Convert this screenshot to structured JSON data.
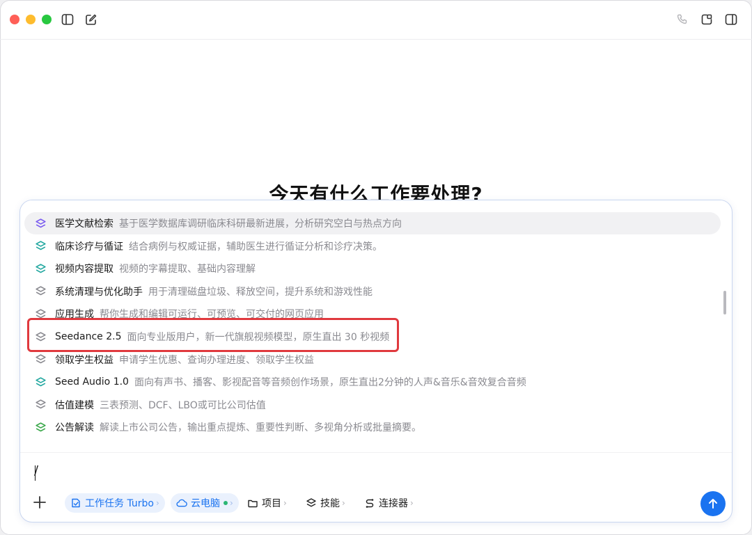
{
  "titlebar": {
    "icons": [
      "sidebar-toggle-icon",
      "new-chat-icon",
      "phone-icon",
      "share-window-icon",
      "panel-icon"
    ]
  },
  "heading": "今天有什么工作要处理?",
  "skills": [
    {
      "name": "医学文献检索",
      "desc": "基于医学数据库调研临床科研最新进展，分析研究空白与热点方向",
      "icon_color": "#7b5cf0",
      "selected": true
    },
    {
      "name": "临床诊疗与循证",
      "desc": "结合病例与权威证据，辅助医生进行循证分析和诊疗决策。",
      "icon_color": "#23a8a0"
    },
    {
      "name": "视频内容提取",
      "desc": "视频的字幕提取、基础内容理解",
      "icon_color": "#23a8a0"
    },
    {
      "name": "系统清理与优化助手",
      "desc": "用于清理磁盘垃圾、释放空间，提升系统和游戏性能",
      "icon_color": "#8a8a90"
    },
    {
      "name": "应用生成",
      "desc": "帮你生成和编辑可运行、可预览、可交付的网页应用",
      "icon_color": "#8a8a90"
    },
    {
      "name": "Seedance 2.5",
      "desc": "面向专业版用户，新一代旗舰视频模型，原生直出 30 秒视频",
      "icon_color": "#8a8a90",
      "highlighted": true
    },
    {
      "name": "领取学生权益",
      "desc": "申请学生优惠、查询办理进度、领取学生权益",
      "icon_color": "#8a8a90"
    },
    {
      "name": "Seed Audio 1.0",
      "desc": "面向有声书、播客、影视配音等音频创作场景，原生直出2分钟的人声&音乐&音效复合音频",
      "icon_color": "#23a8a0"
    },
    {
      "name": "估值建模",
      "desc": "三表预测、DCF、LBO或可比公司估值",
      "icon_color": "#8a8a90"
    },
    {
      "name": "公告解读",
      "desc": "解读上市公司公告，输出重点提炼、重要性判断、多视角分析或批量摘要。",
      "icon_color": "#3aa84a"
    }
  ],
  "input": {
    "value": "/"
  },
  "toolbar": {
    "task_label": "工作任务 Turbo",
    "cloud_label": "云电脑",
    "project_label": "项目",
    "skill_label": "技能",
    "connector_label": "连接器",
    "accent": "#1a73f0",
    "cloud_status_color": "#2bb673"
  }
}
